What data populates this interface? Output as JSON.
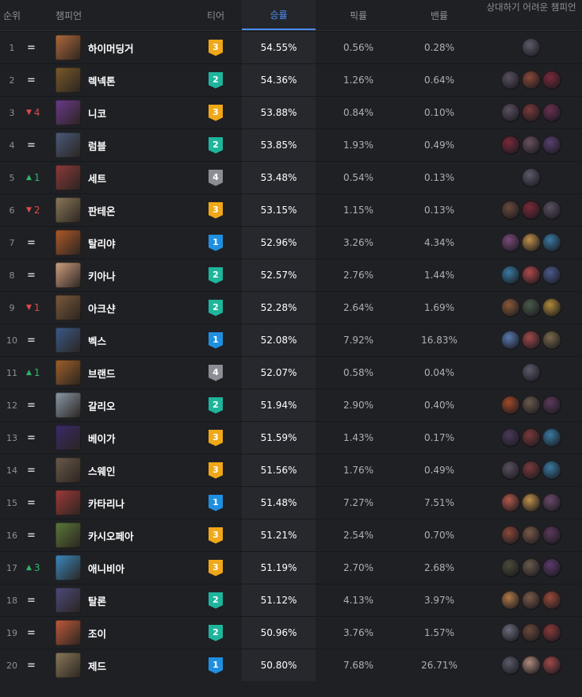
{
  "header": {
    "rank": "순위",
    "champion": "챔피언",
    "tier": "티어",
    "win_rate": "승률",
    "pick_rate": "픽률",
    "ban_rate": "밴률",
    "counters": "상대하기 어려운 챔피언"
  },
  "tier_colors": {
    "1": "#1f8fe0",
    "2": "#1eb59c",
    "3": "#f0a818",
    "4": "#8a8d93"
  },
  "rows": [
    {
      "rank": "1",
      "chg": "=",
      "dir": "eq",
      "name": "하이머딩거",
      "tier": "3",
      "wr": "54.55%",
      "pick": "0.56%",
      "ban": "0.28%",
      "portrait": "#b06a3c",
      "counters": [
        "#5d5a6a"
      ]
    },
    {
      "rank": "2",
      "chg": "=",
      "dir": "eq",
      "name": "렉넥톤",
      "tier": "2",
      "wr": "54.36%",
      "pick": "1.26%",
      "ban": "0.64%",
      "portrait": "#7a5a2a",
      "counters": [
        "#5a5060",
        "#8a4a3a",
        "#7a2a3a"
      ]
    },
    {
      "rank": "3",
      "chg": "4",
      "dir": "dn",
      "name": "니코",
      "tier": "3",
      "wr": "53.88%",
      "pick": "0.84%",
      "ban": "0.10%",
      "portrait": "#6a3a8a",
      "counters": [
        "#5a5060",
        "#7a3a3a",
        "#6a3050"
      ]
    },
    {
      "rank": "4",
      "chg": "=",
      "dir": "eq",
      "name": "럼블",
      "tier": "2",
      "wr": "53.85%",
      "pick": "1.93%",
      "ban": "0.49%",
      "portrait": "#4a5a7a",
      "counters": [
        "#7a2a3a",
        "#6a5060",
        "#5a4070"
      ]
    },
    {
      "rank": "5",
      "chg": "1",
      "dir": "up",
      "name": "세트",
      "tier": "4",
      "wr": "53.48%",
      "pick": "0.54%",
      "ban": "0.13%",
      "portrait": "#8a3a3a",
      "counters": [
        "#5d5a6a"
      ]
    },
    {
      "rank": "6",
      "chg": "2",
      "dir": "dn",
      "name": "판테온",
      "tier": "3",
      "wr": "53.15%",
      "pick": "1.15%",
      "ban": "0.13%",
      "portrait": "#8a7a5a",
      "counters": [
        "#6a4a3a",
        "#7a2a3a",
        "#5a5060"
      ]
    },
    {
      "rank": "7",
      "chg": "=",
      "dir": "eq",
      "name": "탈리야",
      "tier": "1",
      "wr": "52.96%",
      "pick": "3.26%",
      "ban": "4.34%",
      "portrait": "#b05a2a",
      "counters": [
        "#7a4a7a",
        "#c0904a",
        "#3a7aa0"
      ]
    },
    {
      "rank": "8",
      "chg": "=",
      "dir": "eq",
      "name": "키아나",
      "tier": "2",
      "wr": "52.57%",
      "pick": "2.76%",
      "ban": "1.44%",
      "portrait": "#d0a080",
      "counters": [
        "#3a7aa0",
        "#b04a4a",
        "#4a5a8a"
      ]
    },
    {
      "rank": "9",
      "chg": "1",
      "dir": "dn",
      "name": "아크샨",
      "tier": "2",
      "wr": "52.28%",
      "pick": "2.64%",
      "ban": "1.69%",
      "portrait": "#7a5a3a",
      "counters": [
        "#8a5a3a",
        "#4a5a4a",
        "#b08a3a"
      ]
    },
    {
      "rank": "10",
      "chg": "=",
      "dir": "eq",
      "name": "벡스",
      "tier": "1",
      "wr": "52.08%",
      "pick": "7.92%",
      "ban": "16.83%",
      "portrait": "#3a5a8a",
      "counters": [
        "#5a7ab0",
        "#a04a4a",
        "#7a6a4a"
      ]
    },
    {
      "rank": "11",
      "chg": "1",
      "dir": "up",
      "name": "브랜드",
      "tier": "4",
      "wr": "52.07%",
      "pick": "0.58%",
      "ban": "0.04%",
      "portrait": "#a0602a",
      "counters": [
        "#5d5a6a"
      ]
    },
    {
      "rank": "12",
      "chg": "=",
      "dir": "eq",
      "name": "갈리오",
      "tier": "2",
      "wr": "51.94%",
      "pick": "2.90%",
      "ban": "0.40%",
      "portrait": "#8a9aaa",
      "counters": [
        "#a04a2a",
        "#6a5a4a",
        "#5a3a5a"
      ]
    },
    {
      "rank": "13",
      "chg": "=",
      "dir": "eq",
      "name": "베이가",
      "tier": "3",
      "wr": "51.59%",
      "pick": "1.43%",
      "ban": "0.17%",
      "portrait": "#3a2a6a",
      "counters": [
        "#4a3a5a",
        "#7a3a3a",
        "#3a7aa0"
      ]
    },
    {
      "rank": "14",
      "chg": "=",
      "dir": "eq",
      "name": "스웨인",
      "tier": "3",
      "wr": "51.56%",
      "pick": "1.76%",
      "ban": "0.49%",
      "portrait": "#6a5a4a",
      "counters": [
        "#5a5060",
        "#7a3a3a",
        "#3a7aa0"
      ]
    },
    {
      "rank": "15",
      "chg": "=",
      "dir": "eq",
      "name": "카타리나",
      "tier": "1",
      "wr": "51.48%",
      "pick": "7.27%",
      "ban": "7.51%",
      "portrait": "#a03a3a",
      "counters": [
        "#b05a4a",
        "#c0904a",
        "#6a4a6a"
      ]
    },
    {
      "rank": "16",
      "chg": "=",
      "dir": "eq",
      "name": "카시오페아",
      "tier": "3",
      "wr": "51.21%",
      "pick": "2.54%",
      "ban": "0.70%",
      "portrait": "#5a7a3a",
      "counters": [
        "#8a4a3a",
        "#7a5a4a",
        "#5a3a5a"
      ]
    },
    {
      "rank": "17",
      "chg": "3",
      "dir": "up",
      "name": "애니비아",
      "tier": "3",
      "wr": "51.19%",
      "pick": "2.70%",
      "ban": "2.68%",
      "portrait": "#3a8ac0",
      "counters": [
        "#4a4a3a",
        "#6a5a4a",
        "#5a3a6a"
      ]
    },
    {
      "rank": "18",
      "chg": "=",
      "dir": "eq",
      "name": "탈론",
      "tier": "2",
      "wr": "51.12%",
      "pick": "4.13%",
      "ban": "3.97%",
      "portrait": "#4a4a7a",
      "counters": [
        "#b07a4a",
        "#7a5a4a",
        "#9a4a3a"
      ]
    },
    {
      "rank": "19",
      "chg": "=",
      "dir": "eq",
      "name": "조이",
      "tier": "2",
      "wr": "50.96%",
      "pick": "3.76%",
      "ban": "1.57%",
      "portrait": "#c05a3a",
      "counters": [
        "#6a6a7a",
        "#6a4a3a",
        "#8a3a3a"
      ]
    },
    {
      "rank": "20",
      "chg": "=",
      "dir": "eq",
      "name": "제드",
      "tier": "1",
      "wr": "50.80%",
      "pick": "7.68%",
      "ban": "26.71%",
      "portrait": "#8a7a5a",
      "counters": [
        "#5a5a6a",
        "#b08a7a",
        "#a04a4a"
      ]
    }
  ]
}
